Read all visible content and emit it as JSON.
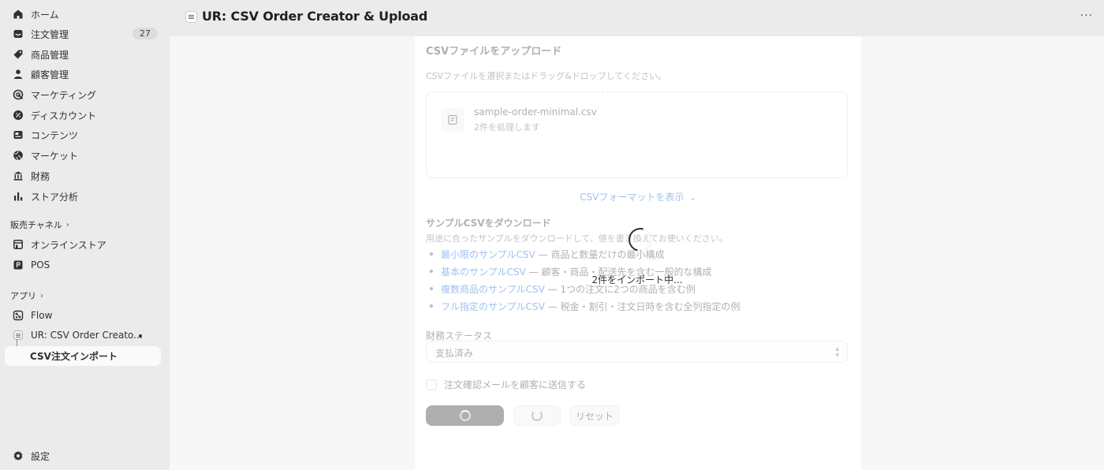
{
  "sidebar": {
    "items": [
      {
        "label": "ホーム",
        "icon": "home-icon"
      },
      {
        "label": "注文管理",
        "icon": "inbox-icon",
        "badge": "27"
      },
      {
        "label": "商品管理",
        "icon": "tag-icon"
      },
      {
        "label": "顧客管理",
        "icon": "person-icon"
      },
      {
        "label": "マーケティング",
        "icon": "target-icon"
      },
      {
        "label": "ディスカウント",
        "icon": "discount-icon"
      },
      {
        "label": "コンテンツ",
        "icon": "content-icon"
      },
      {
        "label": "マーケット",
        "icon": "globe-icon"
      },
      {
        "label": "財務",
        "icon": "bank-icon"
      },
      {
        "label": "ストア分析",
        "icon": "bar-chart-icon"
      }
    ],
    "sales_channels": {
      "heading": "販売チャネル",
      "items": [
        {
          "label": "オンラインストア",
          "icon": "store-icon"
        },
        {
          "label": "POS",
          "icon": "pos-icon"
        }
      ]
    },
    "apps": {
      "heading": "アプリ",
      "items": [
        {
          "label": "Flow",
          "icon": "flow-icon"
        },
        {
          "label": "UR: CSV Order Creato...",
          "icon": "app-icon"
        }
      ],
      "sub_item": "CSV注文インポート"
    },
    "settings": {
      "label": "設定",
      "icon": "gear-icon"
    }
  },
  "header": {
    "title": "UR: CSV Order Creator & Upload",
    "more": "···"
  },
  "upload": {
    "title": "CSVファイルをアップロード",
    "description": "CSVファイルを選択またはドラッグ&ドロップしてください。",
    "file_name": "sample-order-minimal.csv",
    "file_meta": "2件を処理します",
    "format_link": "CSVフォーマットを表示"
  },
  "samples": {
    "title": "サンプルCSVをダウンロード",
    "description": "用途に合ったサンプルをダウンロードして、値を書き換えてお使いください。",
    "items": [
      {
        "link": "最小限のサンプルCSV",
        "desc": " — 商品と数量だけの最小構成"
      },
      {
        "link": "基本のサンプルCSV",
        "desc": " — 顧客・商品・配送先を含む一般的な構成"
      },
      {
        "link": "複数商品のサンプルCSV",
        "desc": " — 1つの注文に2つの商品を含む例"
      },
      {
        "link": "フル指定のサンプルCSV",
        "desc": " — 税金・割引・注文日時を含む全列指定の例"
      }
    ]
  },
  "financial": {
    "label": "財務ステータス",
    "value": "支払済み"
  },
  "email_checkbox": "注文確認メールを顧客に送信する",
  "buttons": {
    "reset": "リセット"
  },
  "loading": {
    "text": "2件をインポート中..."
  }
}
